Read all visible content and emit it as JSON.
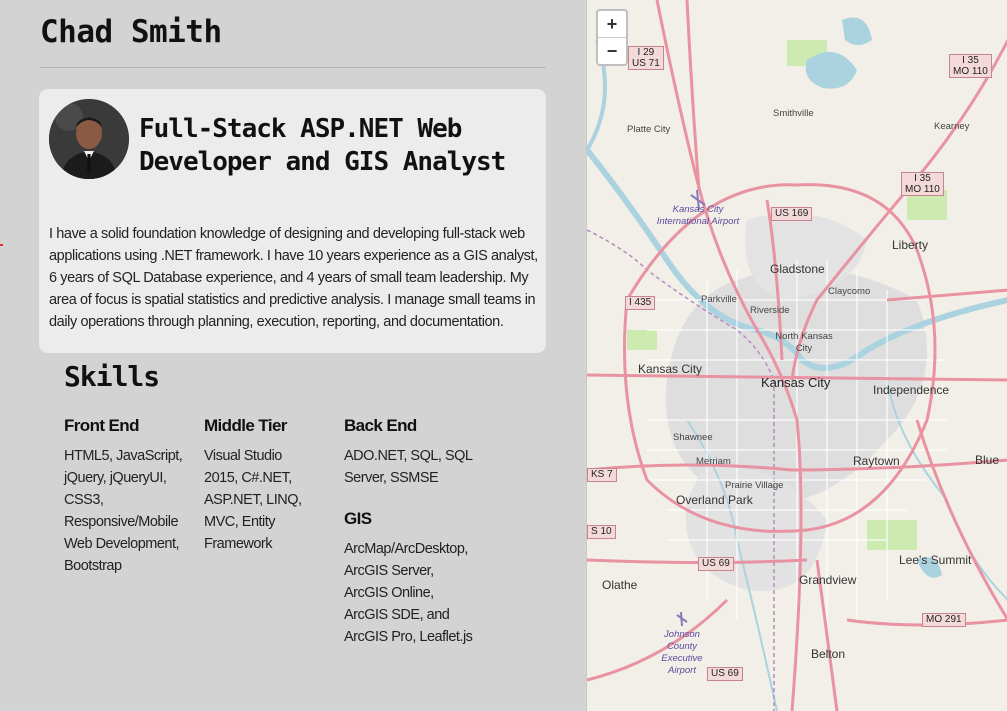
{
  "profile": {
    "name": "Chad Smith",
    "headline": "Full-Stack ASP.NET Web Developer and GIS Analyst",
    "bio": "I have a solid foundation knowledge of designing and developing full-stack web applications using .NET framework. I have 10 years experience as a GIS analyst, 6 years of SQL Database experience, and 4 years of small team leadership. My area of focus is spatial statistics and predictive analysis. I manage small teams in daily operations through planning, execution, reporting, and documentation."
  },
  "skills": {
    "title": "Skills",
    "front_end": {
      "title": "Front End",
      "text": "HTML5, JavaScript, jQuery, jQueryUI, CSS3, Responsive/Mobile Web Development, Bootstrap"
    },
    "middle_tier": {
      "title": "Middle Tier",
      "text": "Visual Studio 2015, C#.NET, ASP.NET, LINQ, MVC, Entity Framework"
    },
    "back_end": {
      "title": "Back End",
      "text": "ADO.NET, SQL, SQL Server, SSMSE"
    },
    "gis": {
      "title": "GIS",
      "text": "ArcMap/ArcDesktop, ArcGIS Server, ArcGIS Online, ArcGIS SDE, and ArcGIS Pro, Leaflet.js"
    }
  },
  "map": {
    "zoom_in": "+",
    "zoom_out": "−",
    "places": {
      "smithville": "Smithville",
      "platte_city": "Platte City",
      "kearney": "Kearney",
      "liberty": "Liberty",
      "gladstone": "Gladstone",
      "claycomo": "Claycomo",
      "parkville": "Parkville",
      "riverside": "Riverside",
      "north_kc": "North Kansas City",
      "kansas_city_ks": "Kansas City",
      "kansas_city_mo": "Kansas City",
      "independence": "Independence",
      "shawnee": "Shawnee",
      "merriam": "Merriam",
      "raytown": "Raytown",
      "blue": "Blue",
      "prairie_village": "Prairie Village",
      "overland_park": "Overland Park",
      "lees_summit": "Lee's Summit",
      "olathe": "Olathe",
      "grandview": "Grandview",
      "belton": "Belton"
    },
    "airports": {
      "kci": "Kansas City International Airport",
      "johnson": "Johnson County Executive Airport"
    },
    "shields": {
      "i29": "I 29",
      "us71": "US 71",
      "i35_top": "I 35",
      "mo110_top": "MO 110",
      "i35_mid": "I 35",
      "mo110_mid": "MO 110",
      "us169": "US 169",
      "i435": "I 435",
      "ks7": "KS 7",
      "s10": "S 10",
      "us69_a": "US 69",
      "us69_b": "US 69",
      "mo291": "MO 291"
    },
    "colors": {
      "land": "#f2efe9",
      "water": "#aad3df",
      "highway": "#e892a2",
      "urban": "#dcdcdc",
      "park": "#cdebb0"
    }
  }
}
